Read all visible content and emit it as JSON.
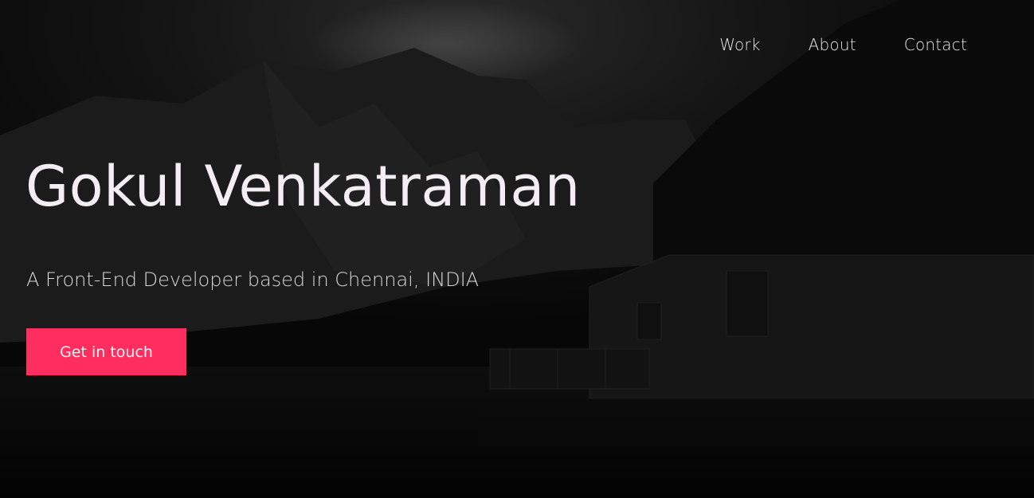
{
  "nav": {
    "items": [
      {
        "label": "Work"
      },
      {
        "label": "About"
      },
      {
        "label": "Contact"
      }
    ]
  },
  "hero": {
    "title": "Gokul Venkatraman",
    "subtitle": "A Front-End Developer based in Chennai, INDIA",
    "cta_label": "Get in touch"
  },
  "colors": {
    "background": "#060606",
    "accent": "#ff2e5f",
    "title_text": "#f4eef4",
    "nav_text": "#e6e6e6"
  }
}
